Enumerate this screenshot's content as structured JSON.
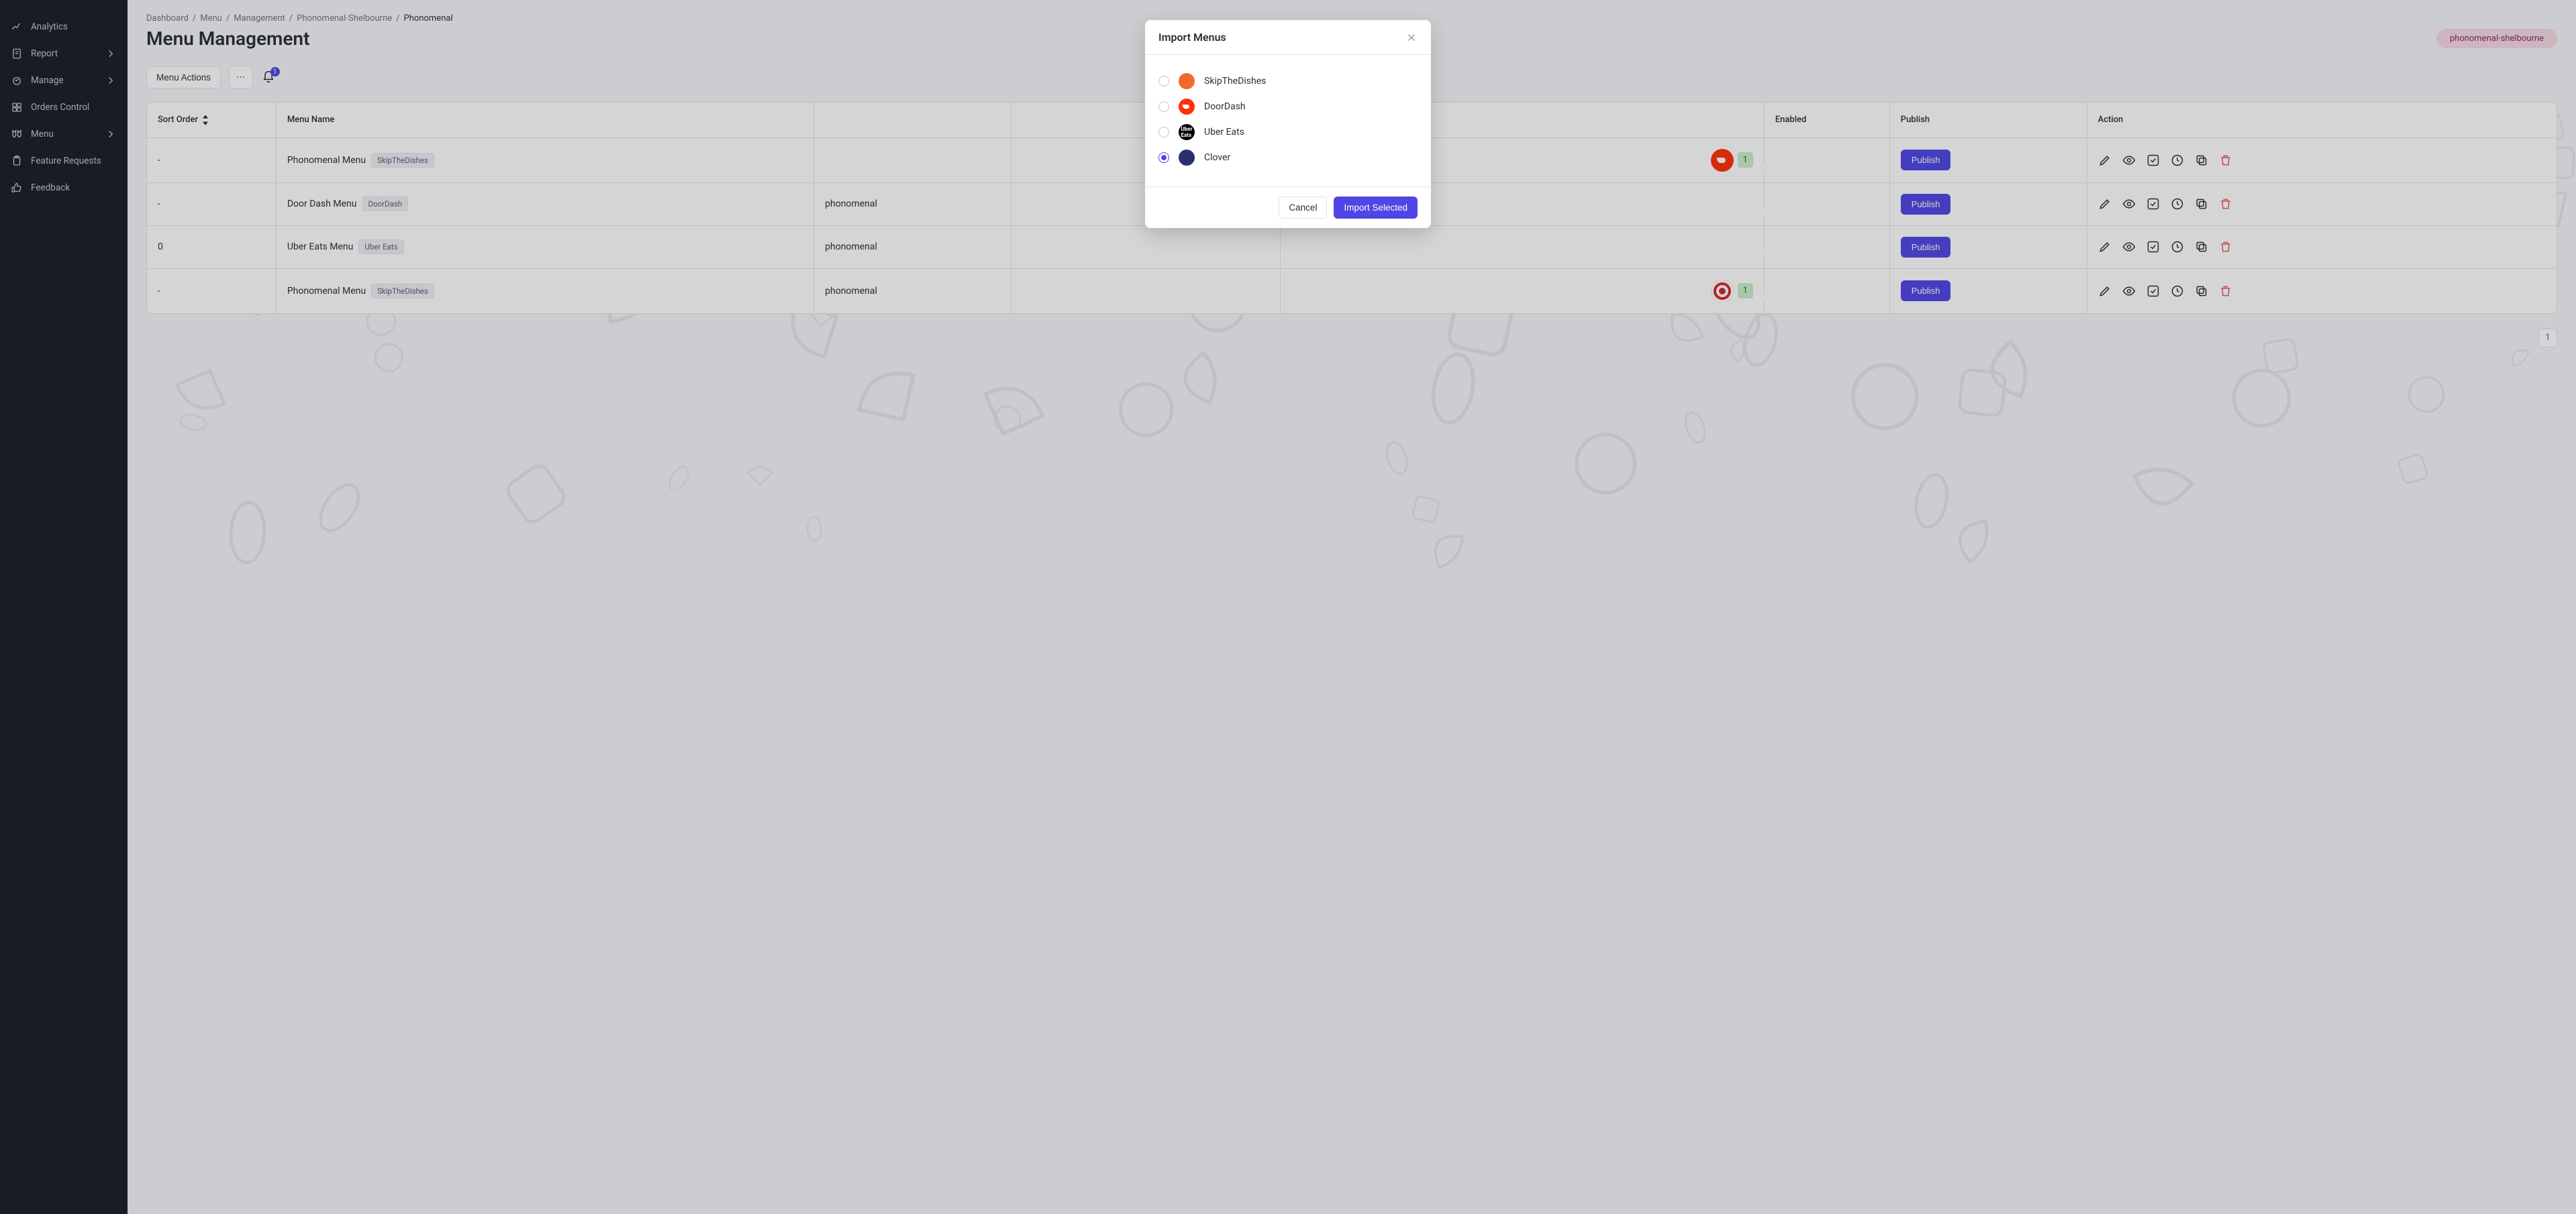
{
  "sidebar": {
    "items": [
      {
        "label": "Analytics",
        "icon": "analytics"
      },
      {
        "label": "Report",
        "icon": "report",
        "chev": true
      },
      {
        "label": "Manage",
        "icon": "manage",
        "chev": true
      },
      {
        "label": "Orders Control",
        "icon": "orders"
      },
      {
        "label": "Menu",
        "icon": "menu",
        "chev": true
      },
      {
        "label": "Feature Requests",
        "icon": "clipboard"
      },
      {
        "label": "Feedback",
        "icon": "thumb"
      }
    ]
  },
  "breadcrumbs": [
    {
      "label": "Dashboard"
    },
    {
      "label": "Menu"
    },
    {
      "label": "Management"
    },
    {
      "label": "Phonomenal-Shelbourne"
    },
    {
      "label": "Phonomenal",
      "current": true
    }
  ],
  "page": {
    "title": "Menu Management",
    "brand_pill": "phonomenal-shelbourne",
    "menu_actions_label": "Menu Actions",
    "notif_count": "1"
  },
  "table": {
    "headers": {
      "sort": "Sort Order",
      "name": "Menu Name",
      "brand": "",
      "ext": "",
      "providers": "",
      "enabled": "Enabled",
      "publish": "Publish",
      "action": "Action"
    },
    "publish_label": "Publish",
    "rows": [
      {
        "sort": "-",
        "name": "Phonomenal Menu",
        "tag": "SkipTheDishes",
        "brand": "",
        "ext": "",
        "prov_icon": "doordash",
        "prov_count": "1"
      },
      {
        "sort": "-",
        "name": "Door Dash Menu",
        "tag": "DoorDash",
        "brand": "phonomenal",
        "ext": "",
        "prov_icon": "",
        "prov_count": ""
      },
      {
        "sort": "0",
        "name": "Uber Eats Menu",
        "tag": "Uber Eats",
        "brand": "phonomenal",
        "ext": "",
        "prov_icon": "",
        "prov_count": ""
      },
      {
        "sort": "-",
        "name": "Phonomenal Menu",
        "tag": "SkipTheDishes",
        "brand": "phonomenal",
        "ext": "",
        "prov_icon": "target",
        "prov_count": "1"
      }
    ]
  },
  "pager": {
    "page": "1"
  },
  "modal": {
    "title": "Import Menus",
    "options": [
      {
        "label": "SkipTheDishes",
        "icon": "skip",
        "checked": false
      },
      {
        "label": "DoorDash",
        "icon": "dd",
        "checked": false
      },
      {
        "label": "Uber Eats",
        "icon": "uber",
        "checked": false
      },
      {
        "label": "Clover",
        "icon": "clover",
        "checked": true
      }
    ],
    "cancel": "Cancel",
    "submit": "Import Selected"
  }
}
